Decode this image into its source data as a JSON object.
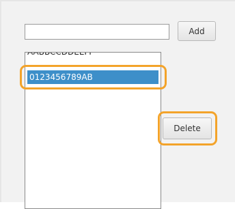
{
  "entry": {
    "value": "",
    "placeholder": ""
  },
  "buttons": {
    "add_label": "Add",
    "delete_label": "Delete"
  },
  "list": {
    "items": [
      {
        "label": "AABBCCDDEEFF",
        "selected": false
      },
      {
        "label": "0123456789AB",
        "selected": true
      }
    ]
  },
  "colors": {
    "selection": "#3d8fc9",
    "highlight": "#f3a32a",
    "panel_background": "#f2f2f2"
  },
  "icons": []
}
